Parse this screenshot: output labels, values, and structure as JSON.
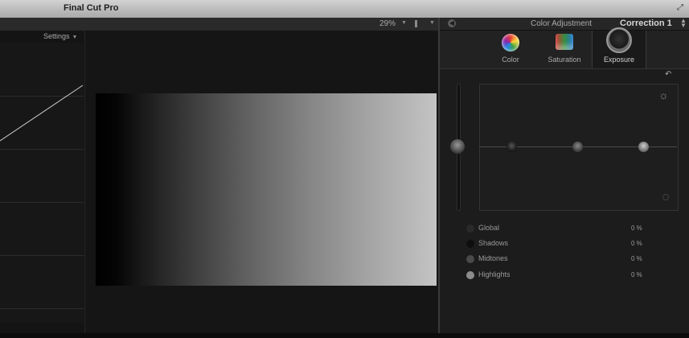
{
  "app": {
    "title": "Final Cut Pro"
  },
  "viewer": {
    "zoom": "29%"
  },
  "scopes": {
    "settings_label": "Settings"
  },
  "inspector": {
    "title": "Color Adjustment",
    "correction": "Correction 1",
    "tabs": [
      {
        "label": "Color",
        "icon": "color-wheel-icon"
      },
      {
        "label": "Saturation",
        "icon": "saturation-icon"
      },
      {
        "label": "Exposure",
        "icon": "exposure-icon",
        "active": true
      }
    ],
    "rows": [
      {
        "name": "Global",
        "value": "0 %",
        "color": "#2a2a2a"
      },
      {
        "name": "Shadows",
        "value": "0 %",
        "color": "#0e0e0e"
      },
      {
        "name": "Midtones",
        "value": "0 %",
        "color": "#4a4a4a"
      },
      {
        "name": "Highlights",
        "value": "0 %",
        "color": "#8c8c8c"
      }
    ]
  }
}
